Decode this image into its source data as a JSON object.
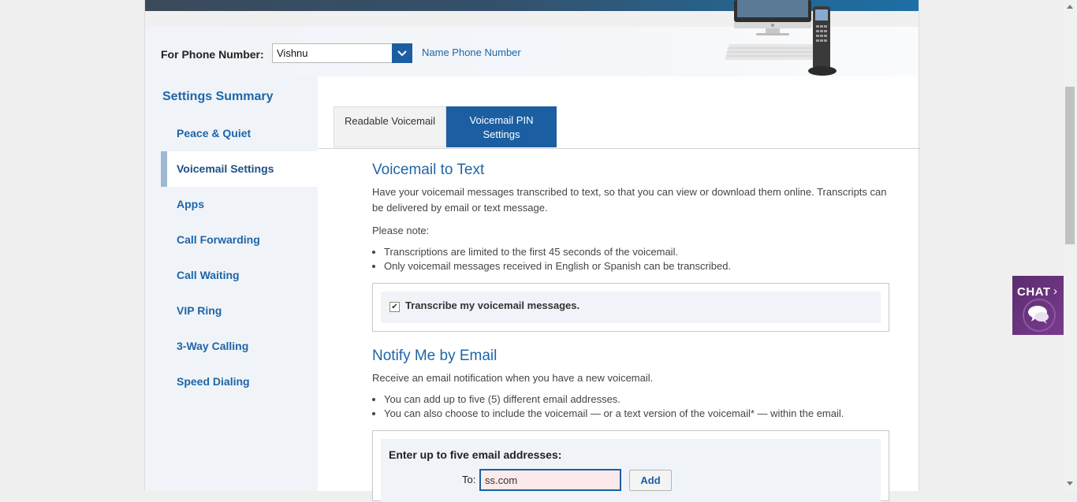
{
  "phone_bar": {
    "label": "For Phone Number:",
    "selected": "Vishnu",
    "name_link": "Name Phone Number"
  },
  "sidebar": {
    "title": "Settings Summary",
    "items": [
      {
        "label": "Peace & Quiet"
      },
      {
        "label": "Voicemail Settings"
      },
      {
        "label": "Apps"
      },
      {
        "label": "Call Forwarding"
      },
      {
        "label": "Call Waiting"
      },
      {
        "label": "VIP Ring"
      },
      {
        "label": "3-Way Calling"
      },
      {
        "label": "Speed Dialing"
      }
    ]
  },
  "tabs": {
    "readable": "Readable Voicemail",
    "pin_line1": "Voicemail PIN",
    "pin_line2": "Settings"
  },
  "voicemail_text": {
    "heading": "Voicemail to Text",
    "description": "Have your voicemail messages transcribed to text, so that you can view or download them online. Transcripts can be delivered by email or text message.",
    "note": "Please note:",
    "bullets": [
      "Transcriptions are limited to the first 45 seconds of the voicemail.",
      "Only voicemail messages received in English or Spanish can be transcribed."
    ],
    "checkbox_label": "Transcribe my voicemail messages."
  },
  "notify_email": {
    "heading": "Notify Me by Email",
    "description": "Receive an email notification when you have a new voicemail.",
    "bullets": [
      "You can add up to five (5) different email addresses.",
      "You can also choose to include the voicemail — or a text version of the voicemail* — within the email."
    ],
    "box_title": "Enter up to five email addresses:",
    "to_label": "To:",
    "input_value": "ss.com",
    "add_button": "Add"
  },
  "chat": {
    "label": "CHAT"
  },
  "colors": {
    "brand_blue": "#1b5fa2",
    "link_blue": "#1f65a8",
    "chat_purple": "#6b3280"
  }
}
